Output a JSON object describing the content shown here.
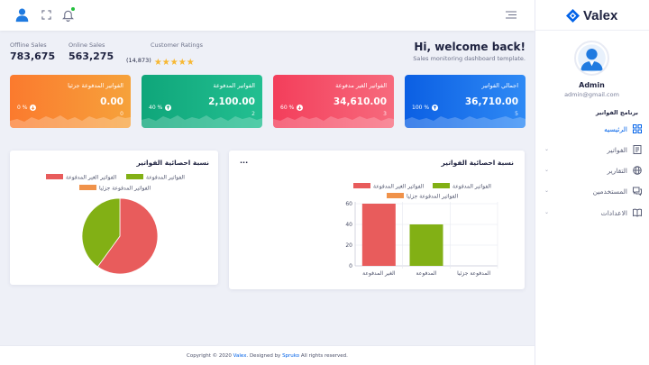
{
  "sidebar": {
    "brand": "Valex",
    "admin_name": "Admin",
    "admin_email": "admin@gmail.com",
    "section_title": "برنامج الفواتير",
    "items": [
      {
        "label": "الرئيسيه",
        "icon": "grid-icon",
        "active": true
      },
      {
        "label": "الفواتير",
        "icon": "invoice-icon",
        "active": false
      },
      {
        "label": "التقارير",
        "icon": "globe-icon",
        "active": false
      },
      {
        "label": "المستخدمين",
        "icon": "chat-icon",
        "active": false
      },
      {
        "label": "الاعدادات",
        "icon": "book-icon",
        "active": false
      }
    ]
  },
  "welcome": {
    "title": "Hi, welcome back!",
    "subtitle": "Sales monitoring dashboard template."
  },
  "stats": {
    "offline_label": "Offline Sales",
    "offline_value": "783,675",
    "online_label": "Online Sales",
    "online_value": "563,275",
    "ratings_label": "Customer Ratings",
    "ratings_count": "(14,873)",
    "rating_stars": 5
  },
  "cards": [
    {
      "title": "اجمالي الفواتير",
      "value": "36,710.00",
      "small": "5",
      "pct": "100 %"
    },
    {
      "title": "الفواتير الغير مدفوعة",
      "value": "34,610.00",
      "small": "3",
      "pct": "60 %"
    },
    {
      "title": "الفواتير المدفوعة",
      "value": "2,100.00",
      "small": "2",
      "pct": "40 %"
    },
    {
      "title": "الفواتير المدفوعة جزئيا",
      "value": "0.00",
      "small": "0",
      "pct": "0 %"
    }
  ],
  "bar_panel": {
    "title": "نسبة احصائية الفواتير",
    "more": "..."
  },
  "pie_panel": {
    "title": "نسبة احصائية الفواتير"
  },
  "colors": {
    "unpaid": "#e85c5c",
    "paid": "#82b015",
    "partial": "#f0924a",
    "accent": "#0162e8"
  },
  "chart_data": [
    {
      "type": "bar",
      "categories": [
        "الغير المدفوعة",
        "المدفوعة",
        "المدفوعة جزئيا"
      ],
      "series": [
        {
          "name": "الفواتير الغير المدفوعة",
          "values": [
            60,
            0,
            0
          ]
        },
        {
          "name": "الفواتير المدفوعة",
          "values": [
            0,
            40,
            0
          ]
        },
        {
          "name": "الفواتير المدفوعة جزئيا",
          "values": [
            0,
            0,
            0
          ]
        }
      ],
      "ylim": [
        0,
        60
      ],
      "yticks": [
        "0",
        "20",
        "40",
        "60"
      ],
      "grid": true,
      "legend": "top"
    },
    {
      "type": "pie",
      "labels": [
        "الفواتير الغير المدفوعة",
        "الفواتير المدفوعة",
        "الفواتير المدفوعة جزئيا"
      ],
      "values": [
        60,
        40,
        0
      ],
      "legend": "top"
    }
  ],
  "footer": {
    "prefix": "Copyright © 2020",
    "brand": "Valex",
    "middle": ". Designed by",
    "designer": "Spruko",
    "suffix": "All rights reserved."
  }
}
